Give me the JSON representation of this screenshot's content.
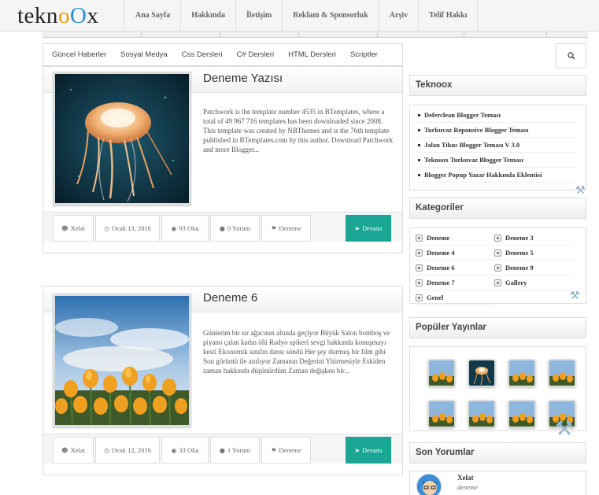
{
  "header": {
    "logo_parts": [
      "tekn",
      "o",
      "O",
      "x"
    ],
    "nav": [
      "Ana Sayfa",
      "Hakkında",
      "İletişim",
      "Reklam & Sponsorluk",
      "Arşiv",
      "Telif Hakkı"
    ]
  },
  "tabs": [
    "Güncel Haberler",
    "Sosyal Medya",
    "Css Dersleri",
    "C# Dersleri",
    "HTML Dersleri",
    "Scriptler"
  ],
  "posts": [
    {
      "title": "Deneme Yazısı",
      "excerpt": "Patchwork is the template number 4535 in BTemplates, where a total of 49 967 716 templates has been downloaded since 2008. This template was created by NBThemes and is the 76th template published in BTemplates.com by this author. Download Patchwork and more Blogger...",
      "author": "Xelat",
      "date": "Ocak 13, 2016",
      "reads": "93 Oku",
      "comments": "0 Yorum",
      "label": "Deneme",
      "more": "Devamı",
      "image": "jellyfish-photo"
    },
    {
      "title": "Deneme 6",
      "excerpt": "Günlerim bir sır ağacının altında geçiyor Büyük Salon bomboş ve piyano çalan kadın ölü Radyo spikeri sevgi hakkında konuşmayı kesti Ekonomik sınıfın dansı söndü Her şey durmuş bir film gibi Son görüntü ile anılıyor Zamanın Değerini Yitirmesiyle Eskiden zaman hakkında düşünürdüm Zaman değişken bir...",
      "author": "Xelat",
      "date": "Ocak 12, 2016",
      "reads": "33 Oku",
      "comments": "1 Yorum",
      "label": "Deneme",
      "more": "Devamı",
      "image": "tulips-photo"
    }
  ],
  "sidebar": {
    "teknoox": {
      "title": "Teknoox",
      "items": [
        "Deferclean Blogger Teması",
        "Turkuvaz Reponsive Blogger Teması",
        "Jalan Tikus Blogger Teması V 3.0",
        "Teknoox Turkuvaz Blogger Teması",
        "Blogger Popup Yazar Hakkında Eklentisi"
      ]
    },
    "categories": {
      "title": "Kategoriler",
      "items": [
        "Deneme",
        "Deneme 3",
        "Deneme 4",
        "Deneme 5",
        "Deneme 6",
        "Deneme 9",
        "Deneme 7",
        "Gallery",
        "Genel"
      ]
    },
    "popular": {
      "title": "Popüler Yayınlar"
    },
    "comments": {
      "title": "Son Yorumlar",
      "author": "Xelat",
      "text": "deneme"
    }
  },
  "colors": {
    "accent": "#1aa594",
    "logo_orange": "#f39c12",
    "logo_blue": "#2a8fd0"
  },
  "icons": {
    "search": "search-icon",
    "user": "user-icon",
    "clock": "clock-icon",
    "eye": "eye-icon",
    "comment": "comment-icon",
    "tag": "tag-icon",
    "arrow": "arrow-circle-icon",
    "tools": "tools-icon"
  }
}
